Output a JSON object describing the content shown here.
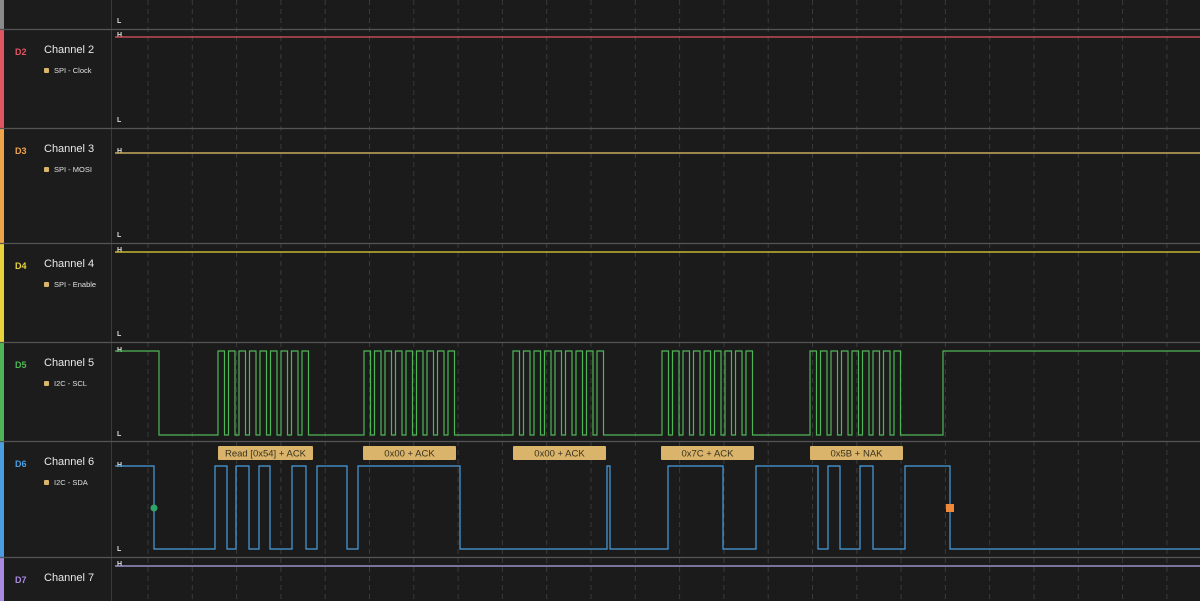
{
  "channels": [
    {
      "id": "",
      "name": "",
      "analyzer": "",
      "color": "#9a9a9a"
    },
    {
      "id": "D2",
      "name": "Channel 2",
      "analyzer": "SPI - Clock",
      "color": "#e05562"
    },
    {
      "id": "D3",
      "name": "Channel 3",
      "analyzer": "SPI - MOSI",
      "color": "#f0a44a"
    },
    {
      "id": "D4",
      "name": "Channel 4",
      "analyzer": "SPI - Enable",
      "color": "#e8d43a"
    },
    {
      "id": "D5",
      "name": "Channel 5",
      "analyzer": "I2C - SCL",
      "color": "#4fb657"
    },
    {
      "id": "D6",
      "name": "Channel 6",
      "analyzer": "I2C - SDA",
      "color": "#4a9ee0"
    },
    {
      "id": "D7",
      "name": "Channel 7",
      "analyzer": "",
      "color": "#a98ae0"
    }
  ],
  "level_high": "H",
  "level_low": "L",
  "i2c_frames": [
    {
      "label": "Read [0x54] + ACK"
    },
    {
      "label": "0x00 + ACK"
    },
    {
      "label": "0x00 + ACK"
    },
    {
      "label": "0x7C + ACK"
    },
    {
      "label": "0x5B + NAK"
    }
  ],
  "colors": {
    "background": "#1b1b1b",
    "grid": "#3a3a3a",
    "separator": "#555555",
    "frame_fill": "#d9b46a",
    "start_marker": "#2fa56b",
    "stop_marker": "#f08a3a"
  }
}
